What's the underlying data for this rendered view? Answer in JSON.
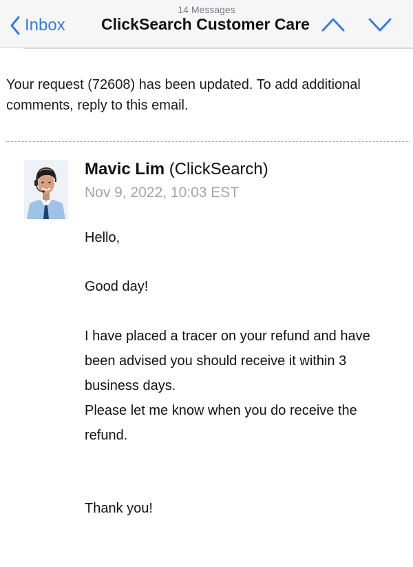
{
  "nav": {
    "back_label": "Inbox",
    "message_count": "14 Messages",
    "title": "ClickSearch Customer Care",
    "back_icon": "chevron-left-icon",
    "prev_icon": "chevron-up-icon",
    "next_icon": "chevron-down-icon"
  },
  "intro": {
    "line1": "Your request (72608) has been updated. To add additional",
    "line2": "comments, reply to this email."
  },
  "message": {
    "sender_name": "Mavic Lim",
    "sender_org": "(ClickSearch)",
    "timestamp": "Nov 9, 2022, 10:03 EST",
    "avatar_icon": "avatar-photo",
    "greeting": "Hello,",
    "opening": "Good day!",
    "para1_line1": "I have placed a tracer on your refund and have",
    "para1_line2": "been advised you should receive it within 3",
    "para1_line3": "business days.",
    "para2_line1": "Please let me know when you do receive the",
    "para2_line2": "refund.",
    "closing": "Thank you!"
  },
  "colors": {
    "accent": "#2f7bf6",
    "navbar_bg": "#f6f6f7",
    "timestamp": "#a3a3a8"
  }
}
